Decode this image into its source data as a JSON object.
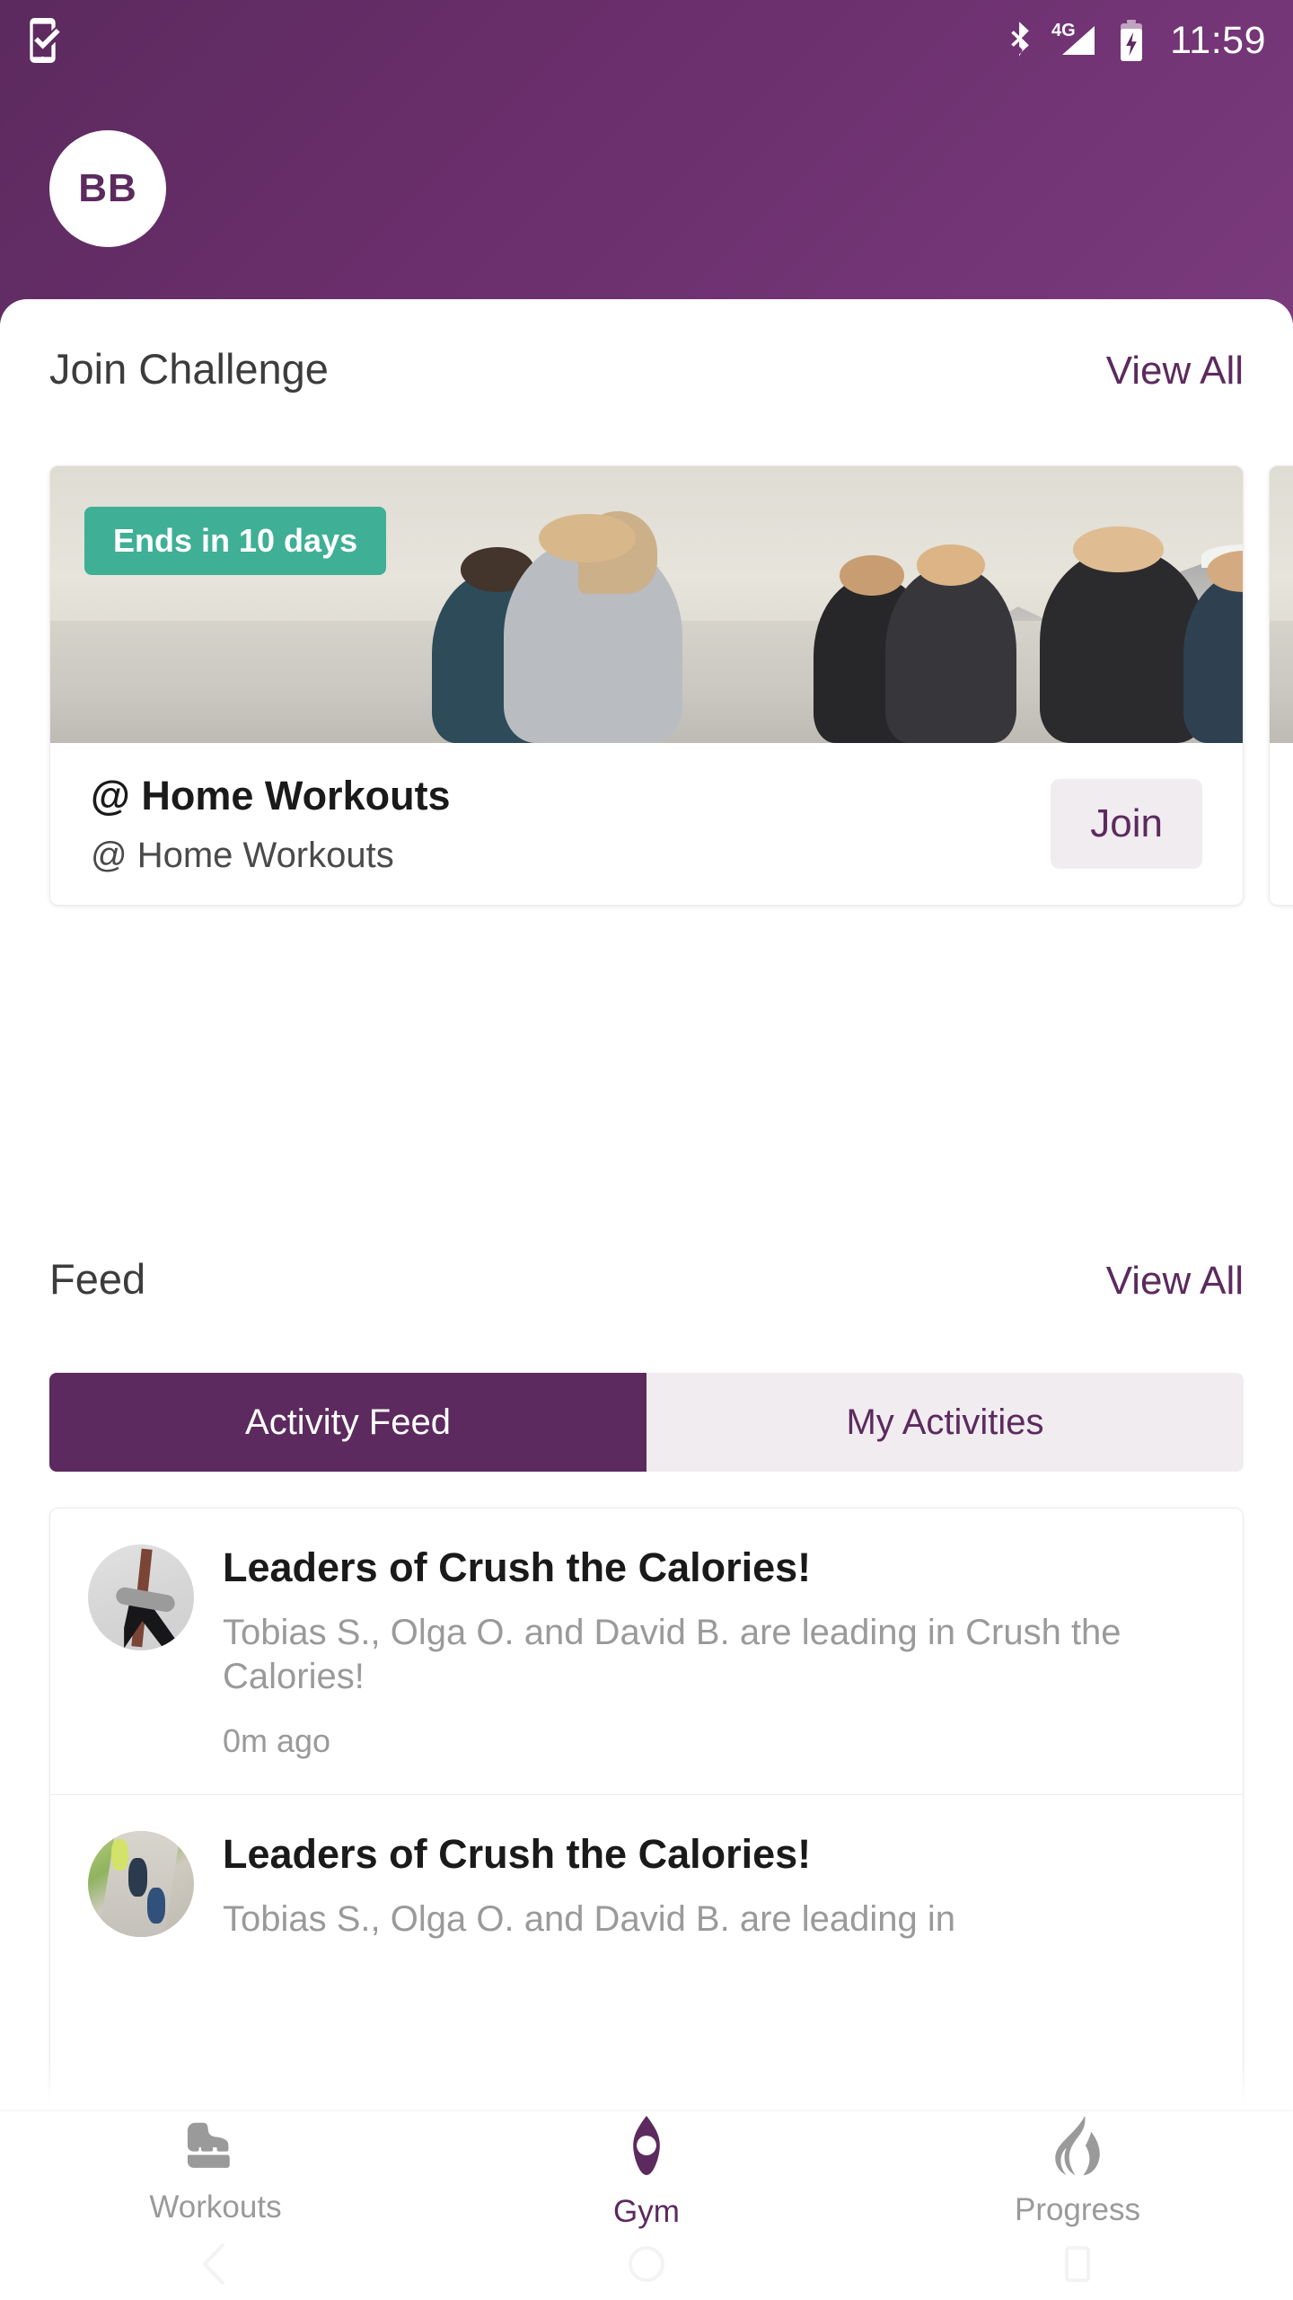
{
  "status_bar": {
    "notification_icon": "phone-check-icon",
    "bluetooth_icon": "bluetooth-icon",
    "network_label": "4G",
    "signal_icon": "signal-bars-icon",
    "battery_icon": "battery-charging-icon",
    "time": "11:59"
  },
  "header": {
    "avatar_initials": "BB",
    "background_color": "#5c2a5e"
  },
  "challenge_section": {
    "title": "Join Challenge",
    "view_all_label": "View All",
    "cards": [
      {
        "badge": "Ends in 10 days",
        "badge_color": "#3faf96",
        "name": "@ Home Workouts",
        "subtitle": "@ Home Workouts",
        "action_label": "Join"
      },
      {
        "badge": "",
        "name": "",
        "subtitle": "",
        "action_label": ""
      }
    ]
  },
  "feed_section": {
    "title": "Feed",
    "view_all_label": "View All",
    "tabs": [
      {
        "label": "Activity Feed",
        "active": true
      },
      {
        "label": "My Activities",
        "active": false
      }
    ],
    "items": [
      {
        "avatar_icon": "yoga-pose-avatar",
        "title": "Leaders of Crush the Calories!",
        "body": "Tobias S., Olga O. and David B. are leading in Crush the Calories!",
        "time": "0m ago"
      },
      {
        "avatar_icon": "running-group-avatar",
        "title": "Leaders of Crush the Calories!",
        "body": "Tobias S., Olga O. and David B. are leading in",
        "time": ""
      }
    ]
  },
  "bottom_nav": {
    "items": [
      {
        "label": "Workouts",
        "icon": "shoe-icon",
        "active": false
      },
      {
        "label": "Gym",
        "icon": "location-pin-icon",
        "active": true
      },
      {
        "label": "Progress",
        "icon": "flame-icon",
        "active": false
      }
    ],
    "active_color": "#5c2a5e",
    "inactive_color": "#9a9a9a"
  },
  "android_nav": {
    "back_icon": "chevron-left-icon",
    "home_icon": "circle-icon",
    "recents_icon": "square-icon"
  }
}
